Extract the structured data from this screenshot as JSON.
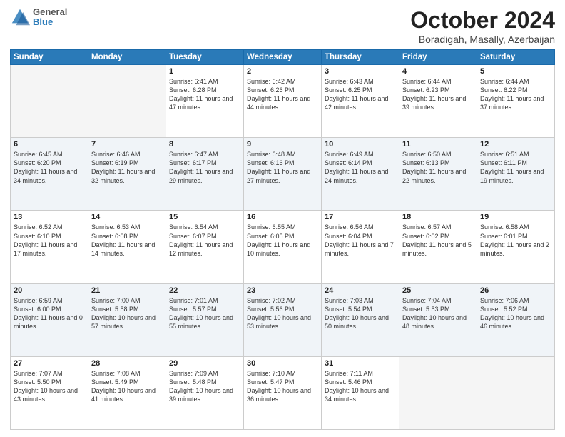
{
  "header": {
    "logo_line1": "General",
    "logo_line2": "Blue",
    "month": "October 2024",
    "location": "Boradigah, Masally, Azerbaijan"
  },
  "days_of_week": [
    "Sunday",
    "Monday",
    "Tuesday",
    "Wednesday",
    "Thursday",
    "Friday",
    "Saturday"
  ],
  "weeks": [
    [
      {
        "day": "",
        "empty": true
      },
      {
        "day": "",
        "empty": true
      },
      {
        "day": "1",
        "sunrise": "6:41 AM",
        "sunset": "6:28 PM",
        "daylight": "11 hours and 47 minutes."
      },
      {
        "day": "2",
        "sunrise": "6:42 AM",
        "sunset": "6:26 PM",
        "daylight": "11 hours and 44 minutes."
      },
      {
        "day": "3",
        "sunrise": "6:43 AM",
        "sunset": "6:25 PM",
        "daylight": "11 hours and 42 minutes."
      },
      {
        "day": "4",
        "sunrise": "6:44 AM",
        "sunset": "6:23 PM",
        "daylight": "11 hours and 39 minutes."
      },
      {
        "day": "5",
        "sunrise": "6:44 AM",
        "sunset": "6:22 PM",
        "daylight": "11 hours and 37 minutes."
      }
    ],
    [
      {
        "day": "6",
        "sunrise": "6:45 AM",
        "sunset": "6:20 PM",
        "daylight": "11 hours and 34 minutes."
      },
      {
        "day": "7",
        "sunrise": "6:46 AM",
        "sunset": "6:19 PM",
        "daylight": "11 hours and 32 minutes."
      },
      {
        "day": "8",
        "sunrise": "6:47 AM",
        "sunset": "6:17 PM",
        "daylight": "11 hours and 29 minutes."
      },
      {
        "day": "9",
        "sunrise": "6:48 AM",
        "sunset": "6:16 PM",
        "daylight": "11 hours and 27 minutes."
      },
      {
        "day": "10",
        "sunrise": "6:49 AM",
        "sunset": "6:14 PM",
        "daylight": "11 hours and 24 minutes."
      },
      {
        "day": "11",
        "sunrise": "6:50 AM",
        "sunset": "6:13 PM",
        "daylight": "11 hours and 22 minutes."
      },
      {
        "day": "12",
        "sunrise": "6:51 AM",
        "sunset": "6:11 PM",
        "daylight": "11 hours and 19 minutes."
      }
    ],
    [
      {
        "day": "13",
        "sunrise": "6:52 AM",
        "sunset": "6:10 PM",
        "daylight": "11 hours and 17 minutes."
      },
      {
        "day": "14",
        "sunrise": "6:53 AM",
        "sunset": "6:08 PM",
        "daylight": "11 hours and 14 minutes."
      },
      {
        "day": "15",
        "sunrise": "6:54 AM",
        "sunset": "6:07 PM",
        "daylight": "11 hours and 12 minutes."
      },
      {
        "day": "16",
        "sunrise": "6:55 AM",
        "sunset": "6:05 PM",
        "daylight": "11 hours and 10 minutes."
      },
      {
        "day": "17",
        "sunrise": "6:56 AM",
        "sunset": "6:04 PM",
        "daylight": "11 hours and 7 minutes."
      },
      {
        "day": "18",
        "sunrise": "6:57 AM",
        "sunset": "6:02 PM",
        "daylight": "11 hours and 5 minutes."
      },
      {
        "day": "19",
        "sunrise": "6:58 AM",
        "sunset": "6:01 PM",
        "daylight": "11 hours and 2 minutes."
      }
    ],
    [
      {
        "day": "20",
        "sunrise": "6:59 AM",
        "sunset": "6:00 PM",
        "daylight": "11 hours and 0 minutes."
      },
      {
        "day": "21",
        "sunrise": "7:00 AM",
        "sunset": "5:58 PM",
        "daylight": "10 hours and 57 minutes."
      },
      {
        "day": "22",
        "sunrise": "7:01 AM",
        "sunset": "5:57 PM",
        "daylight": "10 hours and 55 minutes."
      },
      {
        "day": "23",
        "sunrise": "7:02 AM",
        "sunset": "5:56 PM",
        "daylight": "10 hours and 53 minutes."
      },
      {
        "day": "24",
        "sunrise": "7:03 AM",
        "sunset": "5:54 PM",
        "daylight": "10 hours and 50 minutes."
      },
      {
        "day": "25",
        "sunrise": "7:04 AM",
        "sunset": "5:53 PM",
        "daylight": "10 hours and 48 minutes."
      },
      {
        "day": "26",
        "sunrise": "7:06 AM",
        "sunset": "5:52 PM",
        "daylight": "10 hours and 46 minutes."
      }
    ],
    [
      {
        "day": "27",
        "sunrise": "7:07 AM",
        "sunset": "5:50 PM",
        "daylight": "10 hours and 43 minutes."
      },
      {
        "day": "28",
        "sunrise": "7:08 AM",
        "sunset": "5:49 PM",
        "daylight": "10 hours and 41 minutes."
      },
      {
        "day": "29",
        "sunrise": "7:09 AM",
        "sunset": "5:48 PM",
        "daylight": "10 hours and 39 minutes."
      },
      {
        "day": "30",
        "sunrise": "7:10 AM",
        "sunset": "5:47 PM",
        "daylight": "10 hours and 36 minutes."
      },
      {
        "day": "31",
        "sunrise": "7:11 AM",
        "sunset": "5:46 PM",
        "daylight": "10 hours and 34 minutes."
      },
      {
        "day": "",
        "empty": true
      },
      {
        "day": "",
        "empty": true
      }
    ]
  ]
}
